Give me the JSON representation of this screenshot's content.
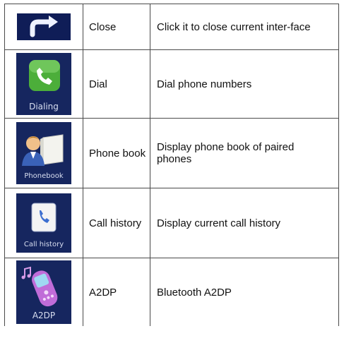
{
  "rows": [
    {
      "icon": "close-arrow-icon",
      "icon_label": "",
      "name": "Close",
      "description": "Click it to close current inter-face"
    },
    {
      "icon": "dialing-phone-icon",
      "icon_label": "Dialing",
      "name": "Dial",
      "description": "Dial phone numbers"
    },
    {
      "icon": "phonebook-icon",
      "icon_label": "Phonebook",
      "name": "Phone book",
      "description": "Display phone book of paired phones"
    },
    {
      "icon": "call-history-icon",
      "icon_label": "Call history",
      "name": "Call history",
      "description": "Display current call history"
    },
    {
      "icon": "a2dp-music-phone-icon",
      "icon_label": "A2DP",
      "name": "A2DP",
      "description": "Bluetooth A2DP"
    }
  ],
  "colors": {
    "icon_background": "#0f1d57",
    "dial_green": "#4cae3a",
    "phone_pink": "#c06cd8",
    "border": "#4a4a4a"
  }
}
